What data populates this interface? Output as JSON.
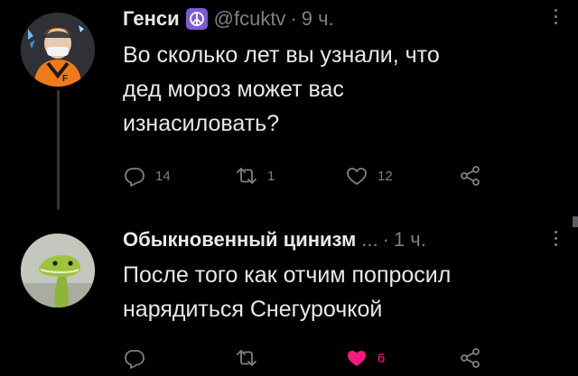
{
  "tweets": [
    {
      "author_name": "Генси",
      "handle": "@fcuktv",
      "separator": "·",
      "time": "9 ч.",
      "text": "Во сколько лет вы узнали, что\nдед мороз может вас\nизнасиловать?",
      "badge_icon": "peace-icon",
      "badge_color": "#7b5cd6",
      "actions": {
        "reply_count": "14",
        "retweet_count": "1",
        "like_count": "12"
      }
    },
    {
      "author_name": "Обыкновенный цинизм",
      "name_ellipsis": "...",
      "separator": "·",
      "time": "1 ч.",
      "text": "После того как отчим попросил\nнарядиться Снегурочкой",
      "actions": {
        "like_count": "6",
        "liked": true
      },
      "like_color": "#f91880"
    }
  ],
  "colors": {
    "background": "#000000",
    "primary_text": "#e7e9ea",
    "secondary_text": "#7c8186"
  }
}
